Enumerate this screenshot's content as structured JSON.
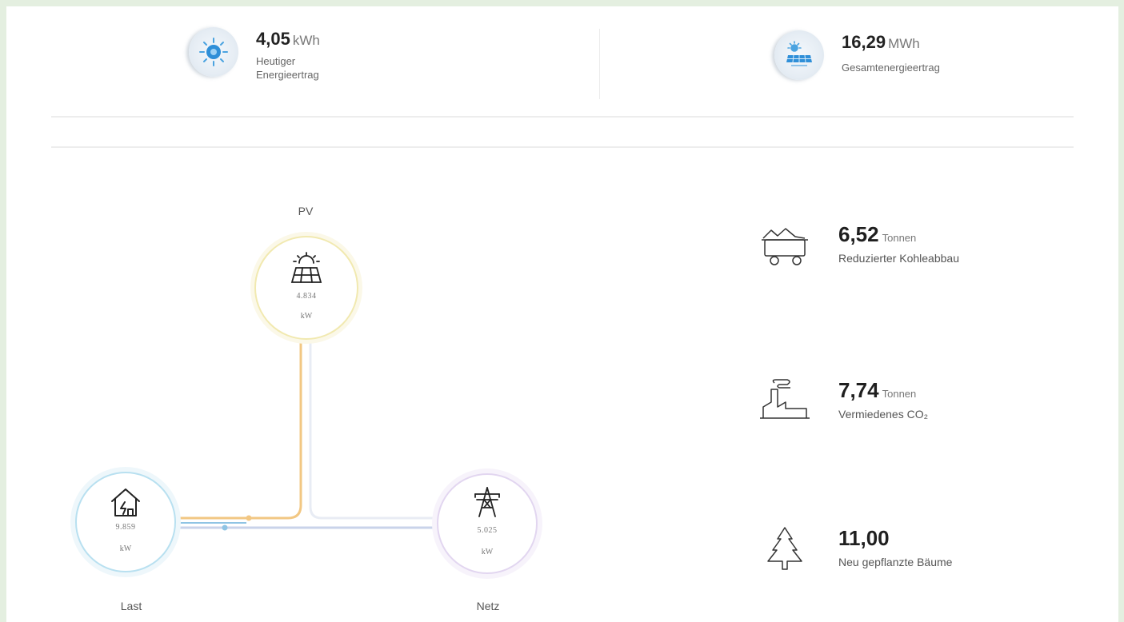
{
  "top_stats": [
    {
      "value": "4,05",
      "unit": "kWh",
      "label": "Heutiger\nEnergieertrag",
      "icon": "sun-icon"
    },
    {
      "value": "16,29",
      "unit": "MWh",
      "label": "Gesamtenergieertrag",
      "icon": "solar-panel-icon"
    }
  ],
  "flow": {
    "pv": {
      "label": "PV",
      "value": "4.834",
      "unit": "kW",
      "color": "#f0e6a0"
    },
    "load": {
      "label": "Last",
      "value": "9.859",
      "unit": "kW",
      "color": "#a8d8ea"
    },
    "grid": {
      "label": "Netz",
      "value": "5.025",
      "unit": "kW",
      "color": "#d9c8ea"
    },
    "line_colors": {
      "pv": "#f2c783",
      "grid": "#c9d3ea",
      "load": "#8fc4e4"
    }
  },
  "env_stats": [
    {
      "value": "6,52",
      "unit": "Tonnen",
      "label": "Reduzierter Kohleabbau",
      "icon": "coal-cart-icon"
    },
    {
      "value": "7,74",
      "unit": "Tonnen",
      "label": "Vermiedenes CO₂",
      "icon": "factory-icon"
    },
    {
      "value": "11,00",
      "unit": "",
      "label": "Neu gepflanzte Bäume",
      "icon": "tree-icon"
    }
  ]
}
